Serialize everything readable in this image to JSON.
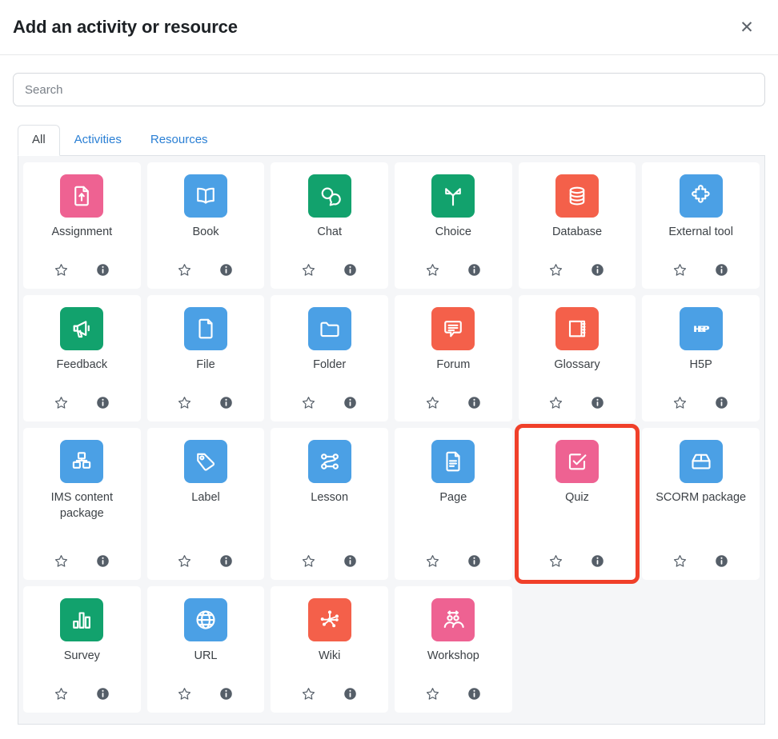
{
  "header": {
    "title": "Add an activity or resource",
    "close_label": "✕"
  },
  "search": {
    "placeholder": "Search",
    "value": ""
  },
  "tabs": [
    {
      "label": "All",
      "active": true
    },
    {
      "label": "Activities",
      "active": false
    },
    {
      "label": "Resources",
      "active": false
    }
  ],
  "colors": {
    "pink": "#ee6292",
    "blue": "#4ba0e5",
    "green": "#12a26d",
    "red": "#f4604a",
    "highlight": "#f0402a",
    "grid_bg": "#f5f6f8",
    "tab_link": "#2a7fd4",
    "text": "#3c4146"
  },
  "items": [
    {
      "label": "Assignment",
      "icon": "assignment-icon",
      "color": "pink",
      "star": "star-outline-icon",
      "info": "info-icon",
      "highlighted": false
    },
    {
      "label": "Book",
      "icon": "book-icon",
      "color": "blue",
      "star": "star-outline-icon",
      "info": "info-icon",
      "highlighted": false
    },
    {
      "label": "Chat",
      "icon": "chat-bubbles-icon",
      "color": "green",
      "star": "star-outline-icon",
      "info": "info-icon",
      "highlighted": false
    },
    {
      "label": "Choice",
      "icon": "fork-choice-icon",
      "color": "green",
      "star": "star-outline-icon",
      "info": "info-icon",
      "highlighted": false
    },
    {
      "label": "Database",
      "icon": "database-icon",
      "color": "red",
      "star": "star-outline-icon",
      "info": "info-icon",
      "highlighted": false
    },
    {
      "label": "External tool",
      "icon": "puzzle-piece-icon",
      "color": "blue",
      "star": "star-outline-icon",
      "info": "info-icon",
      "highlighted": false
    },
    {
      "label": "Feedback",
      "icon": "megaphone-icon",
      "color": "green",
      "star": "star-outline-icon",
      "info": "info-icon",
      "highlighted": false
    },
    {
      "label": "File",
      "icon": "file-icon",
      "color": "blue",
      "star": "star-outline-icon",
      "info": "info-icon",
      "highlighted": false
    },
    {
      "label": "Folder",
      "icon": "folder-icon",
      "color": "blue",
      "star": "star-outline-icon",
      "info": "info-icon",
      "highlighted": false
    },
    {
      "label": "Forum",
      "icon": "forum-icon",
      "color": "red",
      "star": "star-outline-icon",
      "info": "info-icon",
      "highlighted": false
    },
    {
      "label": "Glossary",
      "icon": "glossary-book-icon",
      "color": "red",
      "star": "star-outline-icon",
      "info": "info-icon",
      "highlighted": false
    },
    {
      "label": "H5P",
      "icon": "h5p-logo-icon",
      "color": "blue",
      "star": "star-outline-icon",
      "info": "info-icon",
      "highlighted": false
    },
    {
      "label": "IMS content package",
      "icon": "ims-package-icon",
      "color": "blue",
      "star": "star-outline-icon",
      "info": "info-icon",
      "highlighted": false
    },
    {
      "label": "Label",
      "icon": "tag-icon",
      "color": "blue",
      "star": "star-outline-icon",
      "info": "info-icon",
      "highlighted": false
    },
    {
      "label": "Lesson",
      "icon": "lesson-path-icon",
      "color": "blue",
      "star": "star-outline-icon",
      "info": "info-icon",
      "highlighted": false
    },
    {
      "label": "Page",
      "icon": "page-doc-icon",
      "color": "blue",
      "star": "star-outline-icon",
      "info": "info-icon",
      "highlighted": false
    },
    {
      "label": "Quiz",
      "icon": "quiz-checkbox-icon",
      "color": "pink",
      "star": "star-outline-icon",
      "info": "info-icon",
      "highlighted": true
    },
    {
      "label": "SCORM package",
      "icon": "scorm-box-icon",
      "color": "blue",
      "star": "star-outline-icon",
      "info": "info-icon",
      "highlighted": false
    },
    {
      "label": "Survey",
      "icon": "bar-chart-icon",
      "color": "green",
      "star": "star-outline-icon",
      "info": "info-icon",
      "highlighted": false
    },
    {
      "label": "URL",
      "icon": "globe-icon",
      "color": "blue",
      "star": "star-outline-icon",
      "info": "info-icon",
      "highlighted": false
    },
    {
      "label": "Wiki",
      "icon": "wiki-network-icon",
      "color": "red",
      "star": "star-outline-icon",
      "info": "info-icon",
      "highlighted": false
    },
    {
      "label": "Workshop",
      "icon": "workshop-people-icon",
      "color": "pink",
      "star": "star-outline-icon",
      "info": "info-icon",
      "highlighted": false
    }
  ]
}
